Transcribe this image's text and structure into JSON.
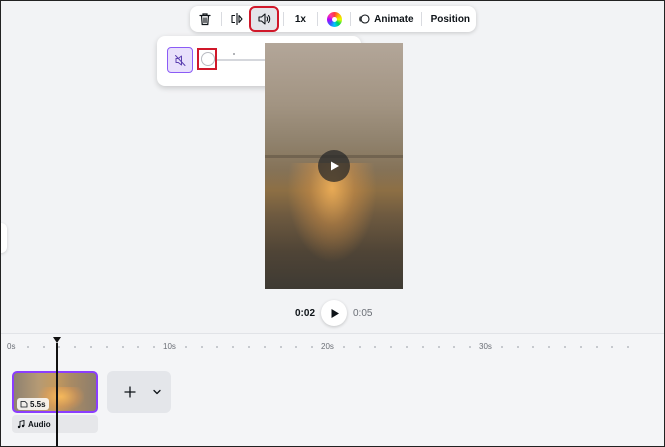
{
  "toolbar": {
    "delete_icon": "trash-icon",
    "flip_icon": "flip-icon",
    "volume_icon": "volume-icon",
    "speed_label": "1x",
    "color_icon": "color-wheel-icon",
    "animate_label": "Animate",
    "position_label": "Position"
  },
  "volume_popover": {
    "mute_icon": "muted-speaker-icon",
    "level_fraction": 0,
    "value": "0"
  },
  "video": {
    "play_icon": "play-icon"
  },
  "playback": {
    "current_time": "0:02",
    "duration": "0:05"
  },
  "timeline": {
    "ruler": [
      "0s",
      "10s",
      "20s",
      "30s"
    ],
    "clip": {
      "duration": "5.5s"
    },
    "audio_label": "Audio",
    "add_icon": "plus-icon",
    "expand_icon": "chevron-down-icon"
  },
  "colors": {
    "accent": "#8b3dff",
    "highlight": "#d0182a"
  }
}
